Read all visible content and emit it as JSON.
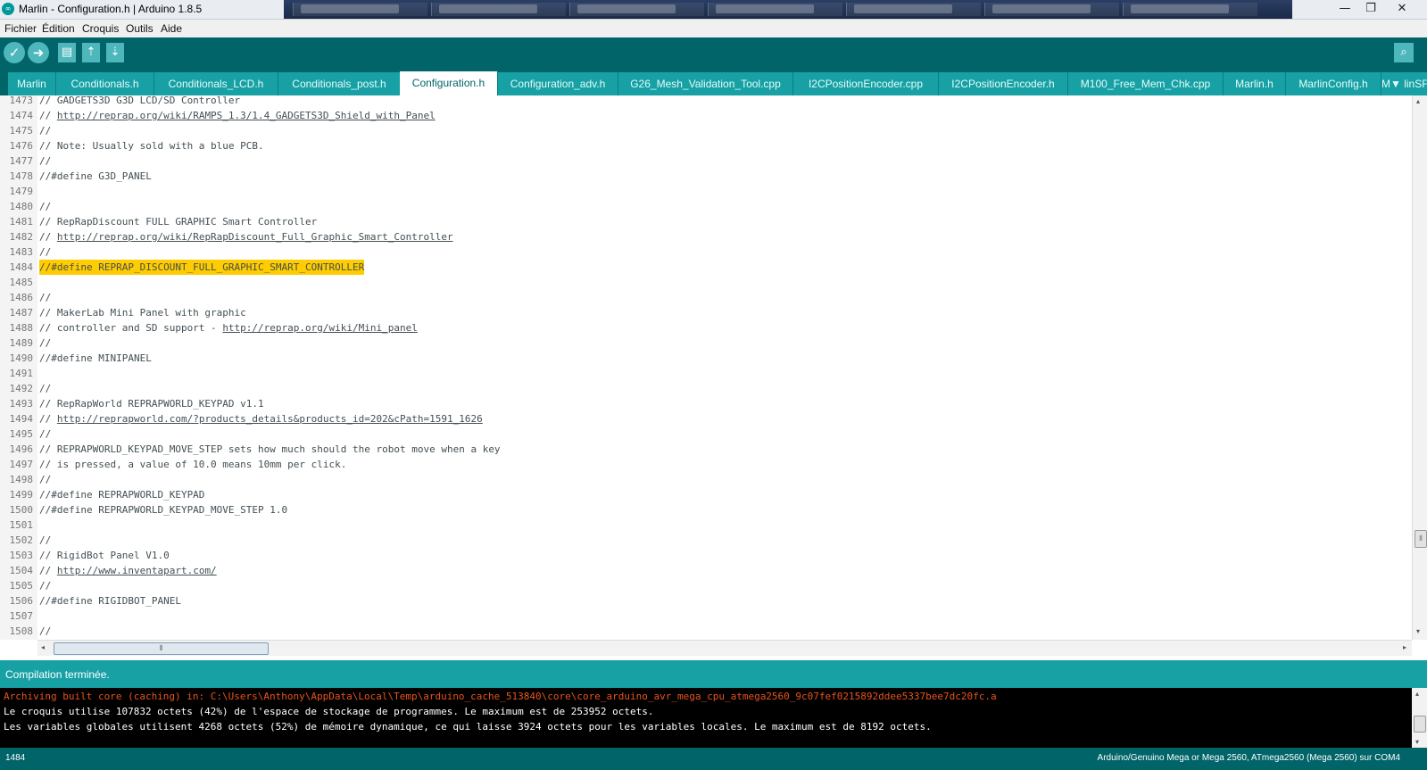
{
  "window": {
    "title": "Marlin - Configuration.h | Arduino 1.8.5",
    "logo_text": "∞",
    "minimize": "—",
    "maximize": "❐",
    "close": "✕"
  },
  "menu": [
    "Fichier",
    "Édition",
    "Croquis",
    "Outils",
    "Aide"
  ],
  "toolbar": {
    "verify_icon": "✓",
    "upload_icon": "➜",
    "new_icon": "▤",
    "open_icon": "⇡",
    "save_icon": "⇣",
    "serial_icon": "⌕"
  },
  "tabs": [
    {
      "label": "Marlin"
    },
    {
      "label": "Conditionals.h"
    },
    {
      "label": "Conditionals_LCD.h"
    },
    {
      "label": "Conditionals_post.h"
    },
    {
      "label": "Configuration.h"
    },
    {
      "label": "Configuration_adv.h"
    },
    {
      "label": "G26_Mesh_Validation_Tool.cpp"
    },
    {
      "label": "I2CPositionEncoder.cpp"
    },
    {
      "label": "I2CPositionEncoder.h"
    },
    {
      "label": "M100_Free_Mem_Chk.cpp"
    },
    {
      "label": "Marlin.h"
    },
    {
      "label": "MarlinConfig.h"
    },
    {
      "label": "M▼ linSF"
    }
  ],
  "editor": {
    "lines": [
      {
        "n": "1473",
        "text": "// GADGETS3D G3D LCD/SD Controller"
      },
      {
        "n": "1474",
        "text": "// ",
        "url": "http://reprap.org/wiki/RAMPS_1.3/1.4_GADGETS3D_Shield_with_Panel"
      },
      {
        "n": "1475",
        "text": "//"
      },
      {
        "n": "1476",
        "text": "// Note: Usually sold with a blue PCB."
      },
      {
        "n": "1477",
        "text": "//"
      },
      {
        "n": "1478",
        "text": "//#define G3D_PANEL"
      },
      {
        "n": "1479",
        "text": ""
      },
      {
        "n": "1480",
        "text": "//"
      },
      {
        "n": "1481",
        "text": "// RepRapDiscount FULL GRAPHIC Smart Controller"
      },
      {
        "n": "1482",
        "text": "// ",
        "url": "http://reprap.org/wiki/RepRapDiscount_Full_Graphic_Smart_Controller"
      },
      {
        "n": "1483",
        "text": "//"
      },
      {
        "n": "1484",
        "text": "//#define REPRAP_DISCOUNT_FULL_GRAPHIC_SMART_CONTROLLER"
      },
      {
        "n": "1485",
        "text": ""
      },
      {
        "n": "1486",
        "text": "//"
      },
      {
        "n": "1487",
        "text": "// MakerLab Mini Panel with graphic"
      },
      {
        "n": "1488",
        "text": "// controller and SD support - ",
        "url": "http://reprap.org/wiki/Mini_panel"
      },
      {
        "n": "1489",
        "text": "//"
      },
      {
        "n": "1490",
        "text": "//#define MINIPANEL"
      },
      {
        "n": "1491",
        "text": ""
      },
      {
        "n": "1492",
        "text": "//"
      },
      {
        "n": "1493",
        "text": "// RepRapWorld REPRAPWORLD_KEYPAD v1.1"
      },
      {
        "n": "1494",
        "text": "// ",
        "url": "http://reprapworld.com/?products_details&products_id=202&cPath=1591_1626"
      },
      {
        "n": "1495",
        "text": "//"
      },
      {
        "n": "1496",
        "text": "// REPRAPWORLD_KEYPAD_MOVE_STEP sets how much should the robot move when a key"
      },
      {
        "n": "1497",
        "text": "// is pressed, a value of 10.0 means 10mm per click."
      },
      {
        "n": "1498",
        "text": "//"
      },
      {
        "n": "1499",
        "text": "//#define REPRAPWORLD_KEYPAD"
      },
      {
        "n": "1500",
        "text": "//#define REPRAPWORLD_KEYPAD_MOVE_STEP 1.0"
      },
      {
        "n": "1501",
        "text": ""
      },
      {
        "n": "1502",
        "text": "//"
      },
      {
        "n": "1503",
        "text": "// RigidBot Panel V1.0"
      },
      {
        "n": "1504",
        "text": "// ",
        "url": "http://www.inventapart.com/"
      },
      {
        "n": "1505",
        "text": "//"
      },
      {
        "n": "1506",
        "text": "//#define RIGIDBOT_PANEL"
      },
      {
        "n": "1507",
        "text": ""
      },
      {
        "n": "1508",
        "text": "//"
      }
    ],
    "highlighted_line": "1484",
    "scroll_left": "◂",
    "scroll_right": "▸",
    "scroll_up": "▴",
    "scroll_down": "▾",
    "thumb_grip": "⦀"
  },
  "status": {
    "message": "Compilation terminée."
  },
  "console": {
    "lines": [
      {
        "text": "Archiving built core (caching) in: C:\\Users\\Anthony\\AppData\\Local\\Temp\\arduino_cache_513840\\core\\core_arduino_avr_mega_cpu_atmega2560_9c07fef0215892ddee5337bee7dc20fc.a",
        "color": "#e8541c"
      },
      {
        "text": "Le croquis utilise 107832 octets (42%) de l'espace de stockage de programmes. Le maximum est de 253952 octets.",
        "color": "#ffffff"
      },
      {
        "text": "Les variables globales utilisent 4268 octets (52%) de mémoire dynamique, ce qui laisse 3924 octets pour les variables locales. Le maximum est de 8192 octets.",
        "color": "#ffffff"
      }
    ]
  },
  "footer": {
    "line_number": "1484",
    "board_info": "Arduino/Genuino Mega or Mega 2560, ATmega2560 (Mega 2560) sur COM4"
  },
  "colors": {
    "toolbar": "#006468",
    "tab": "#17a1a5",
    "highlight": "#ffcc00",
    "console_error": "#e8541c"
  }
}
